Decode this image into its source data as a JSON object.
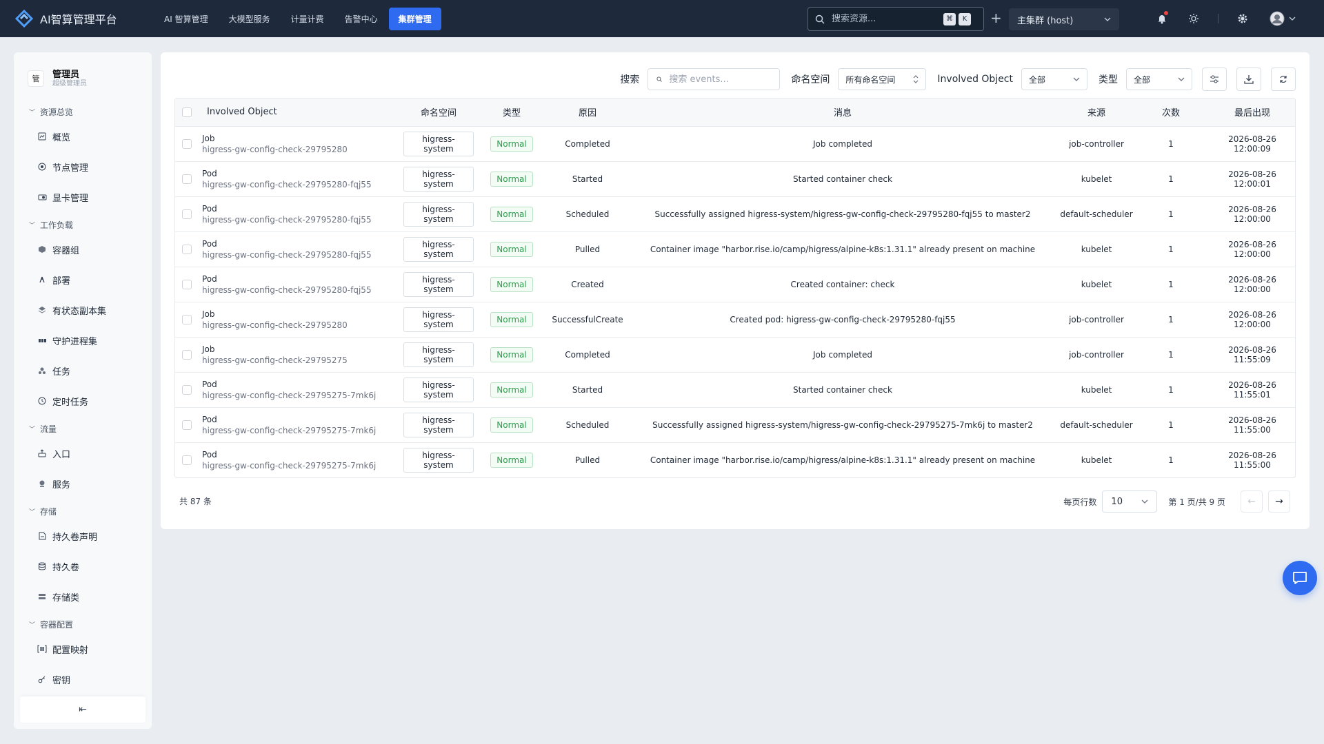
{
  "app": {
    "title": "AI智算管理平台"
  },
  "nav": [
    {
      "label": "AI 智算管理",
      "active": false
    },
    {
      "label": "大模型服务",
      "active": false
    },
    {
      "label": "计量计费",
      "active": false
    },
    {
      "label": "告警中心",
      "active": false
    },
    {
      "label": "集群管理",
      "active": true
    }
  ],
  "top": {
    "search_placeholder": "搜索资源...",
    "kbd_1": "⌘",
    "kbd_2": "K",
    "cluster": "主集群 (host)"
  },
  "user": {
    "avatar": "管",
    "name": "管理员",
    "role": "超级管理员"
  },
  "sidebar": {
    "groups": [
      {
        "label": "资源总览",
        "items": [
          {
            "label": "概览",
            "icon": "dashboard-icon"
          },
          {
            "label": "节点管理",
            "icon": "node-icon"
          },
          {
            "label": "显卡管理",
            "icon": "gpu-icon"
          }
        ]
      },
      {
        "label": "工作负载",
        "items": [
          {
            "label": "容器组",
            "icon": "pod-icon"
          },
          {
            "label": "部署",
            "icon": "deploy-icon"
          },
          {
            "label": "有状态副本集",
            "icon": "layers-icon"
          },
          {
            "label": "守护进程集",
            "icon": "daemonset-icon"
          },
          {
            "label": "任务",
            "icon": "job-icon"
          },
          {
            "label": "定时任务",
            "icon": "clock-icon"
          }
        ]
      },
      {
        "label": "流量",
        "items": [
          {
            "label": "入口",
            "icon": "ingress-icon"
          },
          {
            "label": "服务",
            "icon": "service-icon"
          }
        ]
      },
      {
        "label": "存储",
        "items": [
          {
            "label": "持久卷声明",
            "icon": "pvc-icon"
          },
          {
            "label": "持久卷",
            "icon": "database-icon"
          },
          {
            "label": "存储类",
            "icon": "storageclass-icon"
          }
        ]
      },
      {
        "label": "容器配置",
        "items": [
          {
            "label": "配置映射",
            "icon": "configmap-icon"
          },
          {
            "label": "密钥",
            "icon": "key-icon"
          }
        ]
      }
    ],
    "collapse": "⇤"
  },
  "filters": {
    "search_label": "搜索",
    "search_placeholder": "搜索 events...",
    "namespace_label": "命名空间",
    "namespace_value": "所有命名空间",
    "involved_label": "Involved Object",
    "involved_value": "全部",
    "type_label": "类型",
    "type_value": "全部"
  },
  "table": {
    "headers": {
      "object": "Involved Object",
      "namespace": "命名空间",
      "type": "类型",
      "reason": "原因",
      "message": "消息",
      "source": "来源",
      "count": "次数",
      "last_seen": "最后出现"
    },
    "rows": [
      {
        "kind": "Job",
        "name": "higress-gw-config-check-29795280",
        "namespace": "higress-system",
        "type": "Normal",
        "reason": "Completed",
        "message": "Job completed",
        "source": "job-controller",
        "count": "1",
        "last_seen": "2026-08-26 12:00:09"
      },
      {
        "kind": "Pod",
        "name": "higress-gw-config-check-29795280-fqj55",
        "namespace": "higress-system",
        "type": "Normal",
        "reason": "Started",
        "message": "Started container check",
        "source": "kubelet",
        "count": "1",
        "last_seen": "2026-08-26 12:00:01"
      },
      {
        "kind": "Pod",
        "name": "higress-gw-config-check-29795280-fqj55",
        "namespace": "higress-system",
        "type": "Normal",
        "reason": "Scheduled",
        "message": "Successfully assigned higress-system/higress-gw-config-check-29795280-fqj55 to master2",
        "source": "default-scheduler",
        "count": "1",
        "last_seen": "2026-08-26 12:00:00"
      },
      {
        "kind": "Pod",
        "name": "higress-gw-config-check-29795280-fqj55",
        "namespace": "higress-system",
        "type": "Normal",
        "reason": "Pulled",
        "message": "Container image \"harbor.rise.io/camp/higress/alpine-k8s:1.31.1\" already present on machine",
        "source": "kubelet",
        "count": "1",
        "last_seen": "2026-08-26 12:00:00"
      },
      {
        "kind": "Pod",
        "name": "higress-gw-config-check-29795280-fqj55",
        "namespace": "higress-system",
        "type": "Normal",
        "reason": "Created",
        "message": "Created container: check",
        "source": "kubelet",
        "count": "1",
        "last_seen": "2026-08-26 12:00:00"
      },
      {
        "kind": "Job",
        "name": "higress-gw-config-check-29795280",
        "namespace": "higress-system",
        "type": "Normal",
        "reason": "SuccessfulCreate",
        "message": "Created pod: higress-gw-config-check-29795280-fqj55",
        "source": "job-controller",
        "count": "1",
        "last_seen": "2026-08-26 12:00:00"
      },
      {
        "kind": "Job",
        "name": "higress-gw-config-check-29795275",
        "namespace": "higress-system",
        "type": "Normal",
        "reason": "Completed",
        "message": "Job completed",
        "source": "job-controller",
        "count": "1",
        "last_seen": "2026-08-26 11:55:09"
      },
      {
        "kind": "Pod",
        "name": "higress-gw-config-check-29795275-7mk6j",
        "namespace": "higress-system",
        "type": "Normal",
        "reason": "Started",
        "message": "Started container check",
        "source": "kubelet",
        "count": "1",
        "last_seen": "2026-08-26 11:55:01"
      },
      {
        "kind": "Pod",
        "name": "higress-gw-config-check-29795275-7mk6j",
        "namespace": "higress-system",
        "type": "Normal",
        "reason": "Scheduled",
        "message": "Successfully assigned higress-system/higress-gw-config-check-29795275-7mk6j to master2",
        "source": "default-scheduler",
        "count": "1",
        "last_seen": "2026-08-26 11:55:00"
      },
      {
        "kind": "Pod",
        "name": "higress-gw-config-check-29795275-7mk6j",
        "namespace": "higress-system",
        "type": "Normal",
        "reason": "Pulled",
        "message": "Container image \"harbor.rise.io/camp/higress/alpine-k8s:1.31.1\" already present on machine",
        "source": "kubelet",
        "count": "1",
        "last_seen": "2026-08-26 11:55:00"
      }
    ]
  },
  "footer": {
    "total": "共 87 条",
    "page_size_label": "每页行数",
    "page_size": "10",
    "page_info": "第 1 页/共 9 页",
    "prev": "←",
    "next": "→"
  },
  "colors": {
    "topbar": "#1e2a3b",
    "accent": "#2f6bf0",
    "normal_green": "#2e9d4d"
  }
}
